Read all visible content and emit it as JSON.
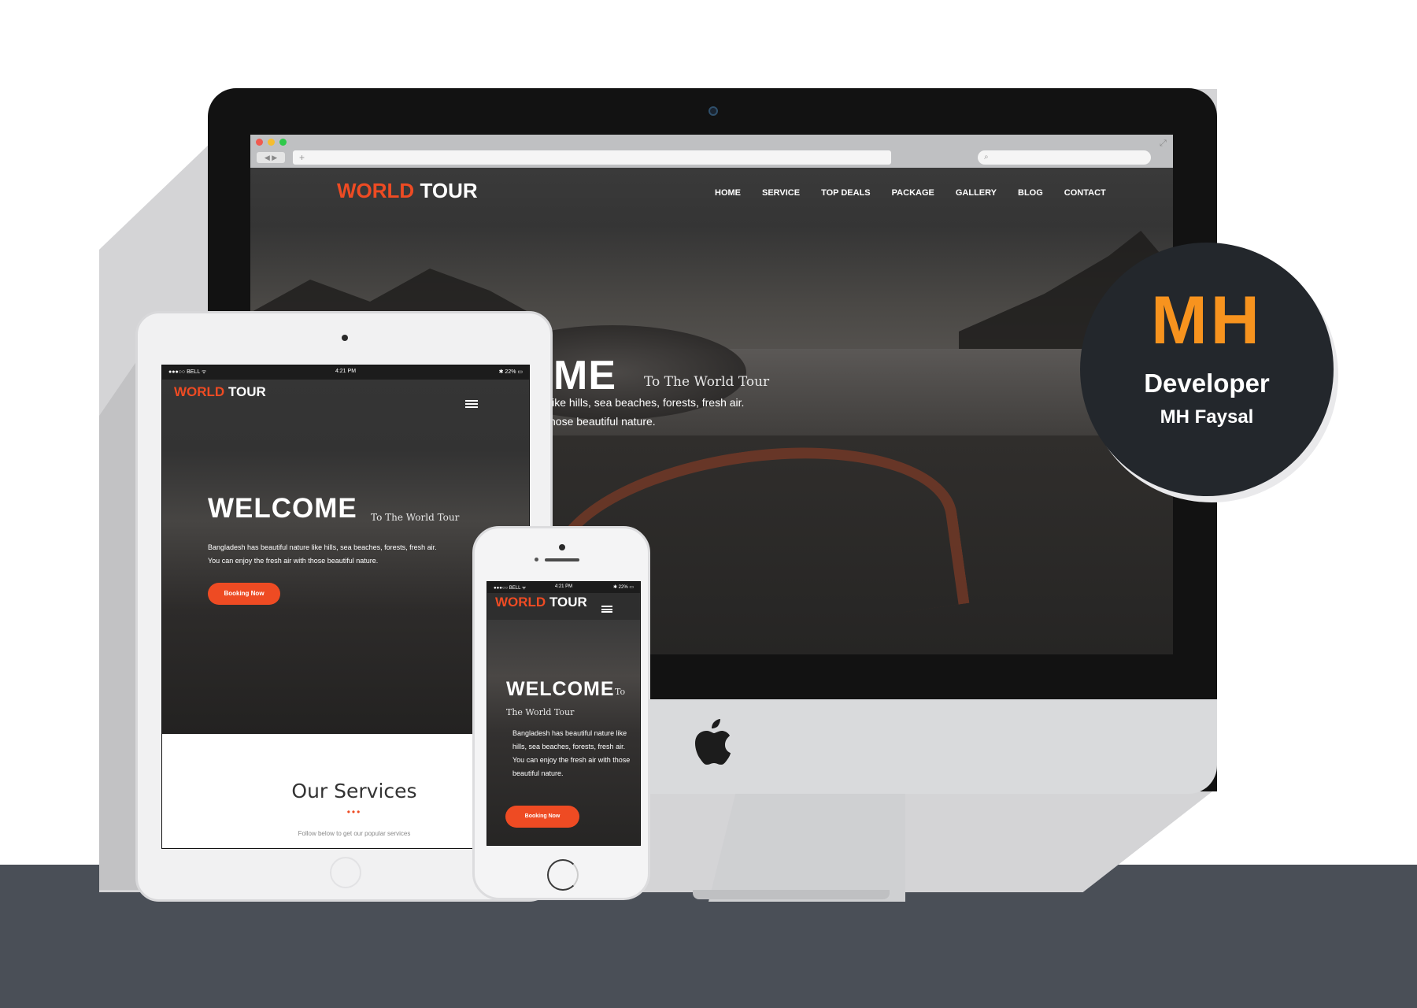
{
  "desktop": {
    "logo_word1": "WORLD",
    "logo_word2": "TOUR",
    "nav": [
      "HOME",
      "SERVICE",
      "TOP DEALS",
      "PACKAGE",
      "GALLERY",
      "BLOG",
      "CONTACT"
    ],
    "hero_heading": "ME",
    "hero_subheading": "To The World Tour",
    "hero_line1": "like hills, sea beaches, forests, fresh air.",
    "hero_line2": "hose beautiful nature.",
    "url_placeholder": "+",
    "nav_arrows": "◀ ▶"
  },
  "badge": {
    "initials": "MH",
    "role": "Developer",
    "name": "MH Faysal",
    "accent_color": "#f7931e"
  },
  "tablet": {
    "status_carrier": "●●●○○ BELL ᯤ",
    "status_time": "4:21 PM",
    "status_battery": "✱ 22% ▭",
    "logo_word1": "WORLD",
    "logo_word2": "TOUR",
    "hero_heading": "WELCOME",
    "hero_subheading": "To The World Tour",
    "hero_line1": "Bangladesh has beautiful nature like hills, sea beaches, forests, fresh air.",
    "hero_line2": "You can enjoy the fresh air with those beautiful nature.",
    "button_label": "Booking Now",
    "services_title": "Our Services",
    "services_dots": "•••",
    "services_subtitle": "Follow below to get our popular services"
  },
  "phone": {
    "status_carrier": "●●●○○ BELL ᯤ",
    "status_time": "4:21 PM",
    "status_battery": "✱ 22% ▭",
    "logo_word1": "WORLD",
    "logo_word2": "TOUR",
    "hero_heading": "WELCOME",
    "hero_to": "To",
    "hero_subheading_rest": "The World Tour",
    "hero_line1": "Bangladesh has beautiful nature like hills, sea beaches, forests, fresh air.",
    "hero_line2": "You can enjoy the fresh air with those beautiful nature.",
    "button_label": "Booking Now"
  },
  "colors": {
    "brand_orange": "#ee4b23",
    "floor": "#4a4f57",
    "badge_bg": "#23272c"
  }
}
